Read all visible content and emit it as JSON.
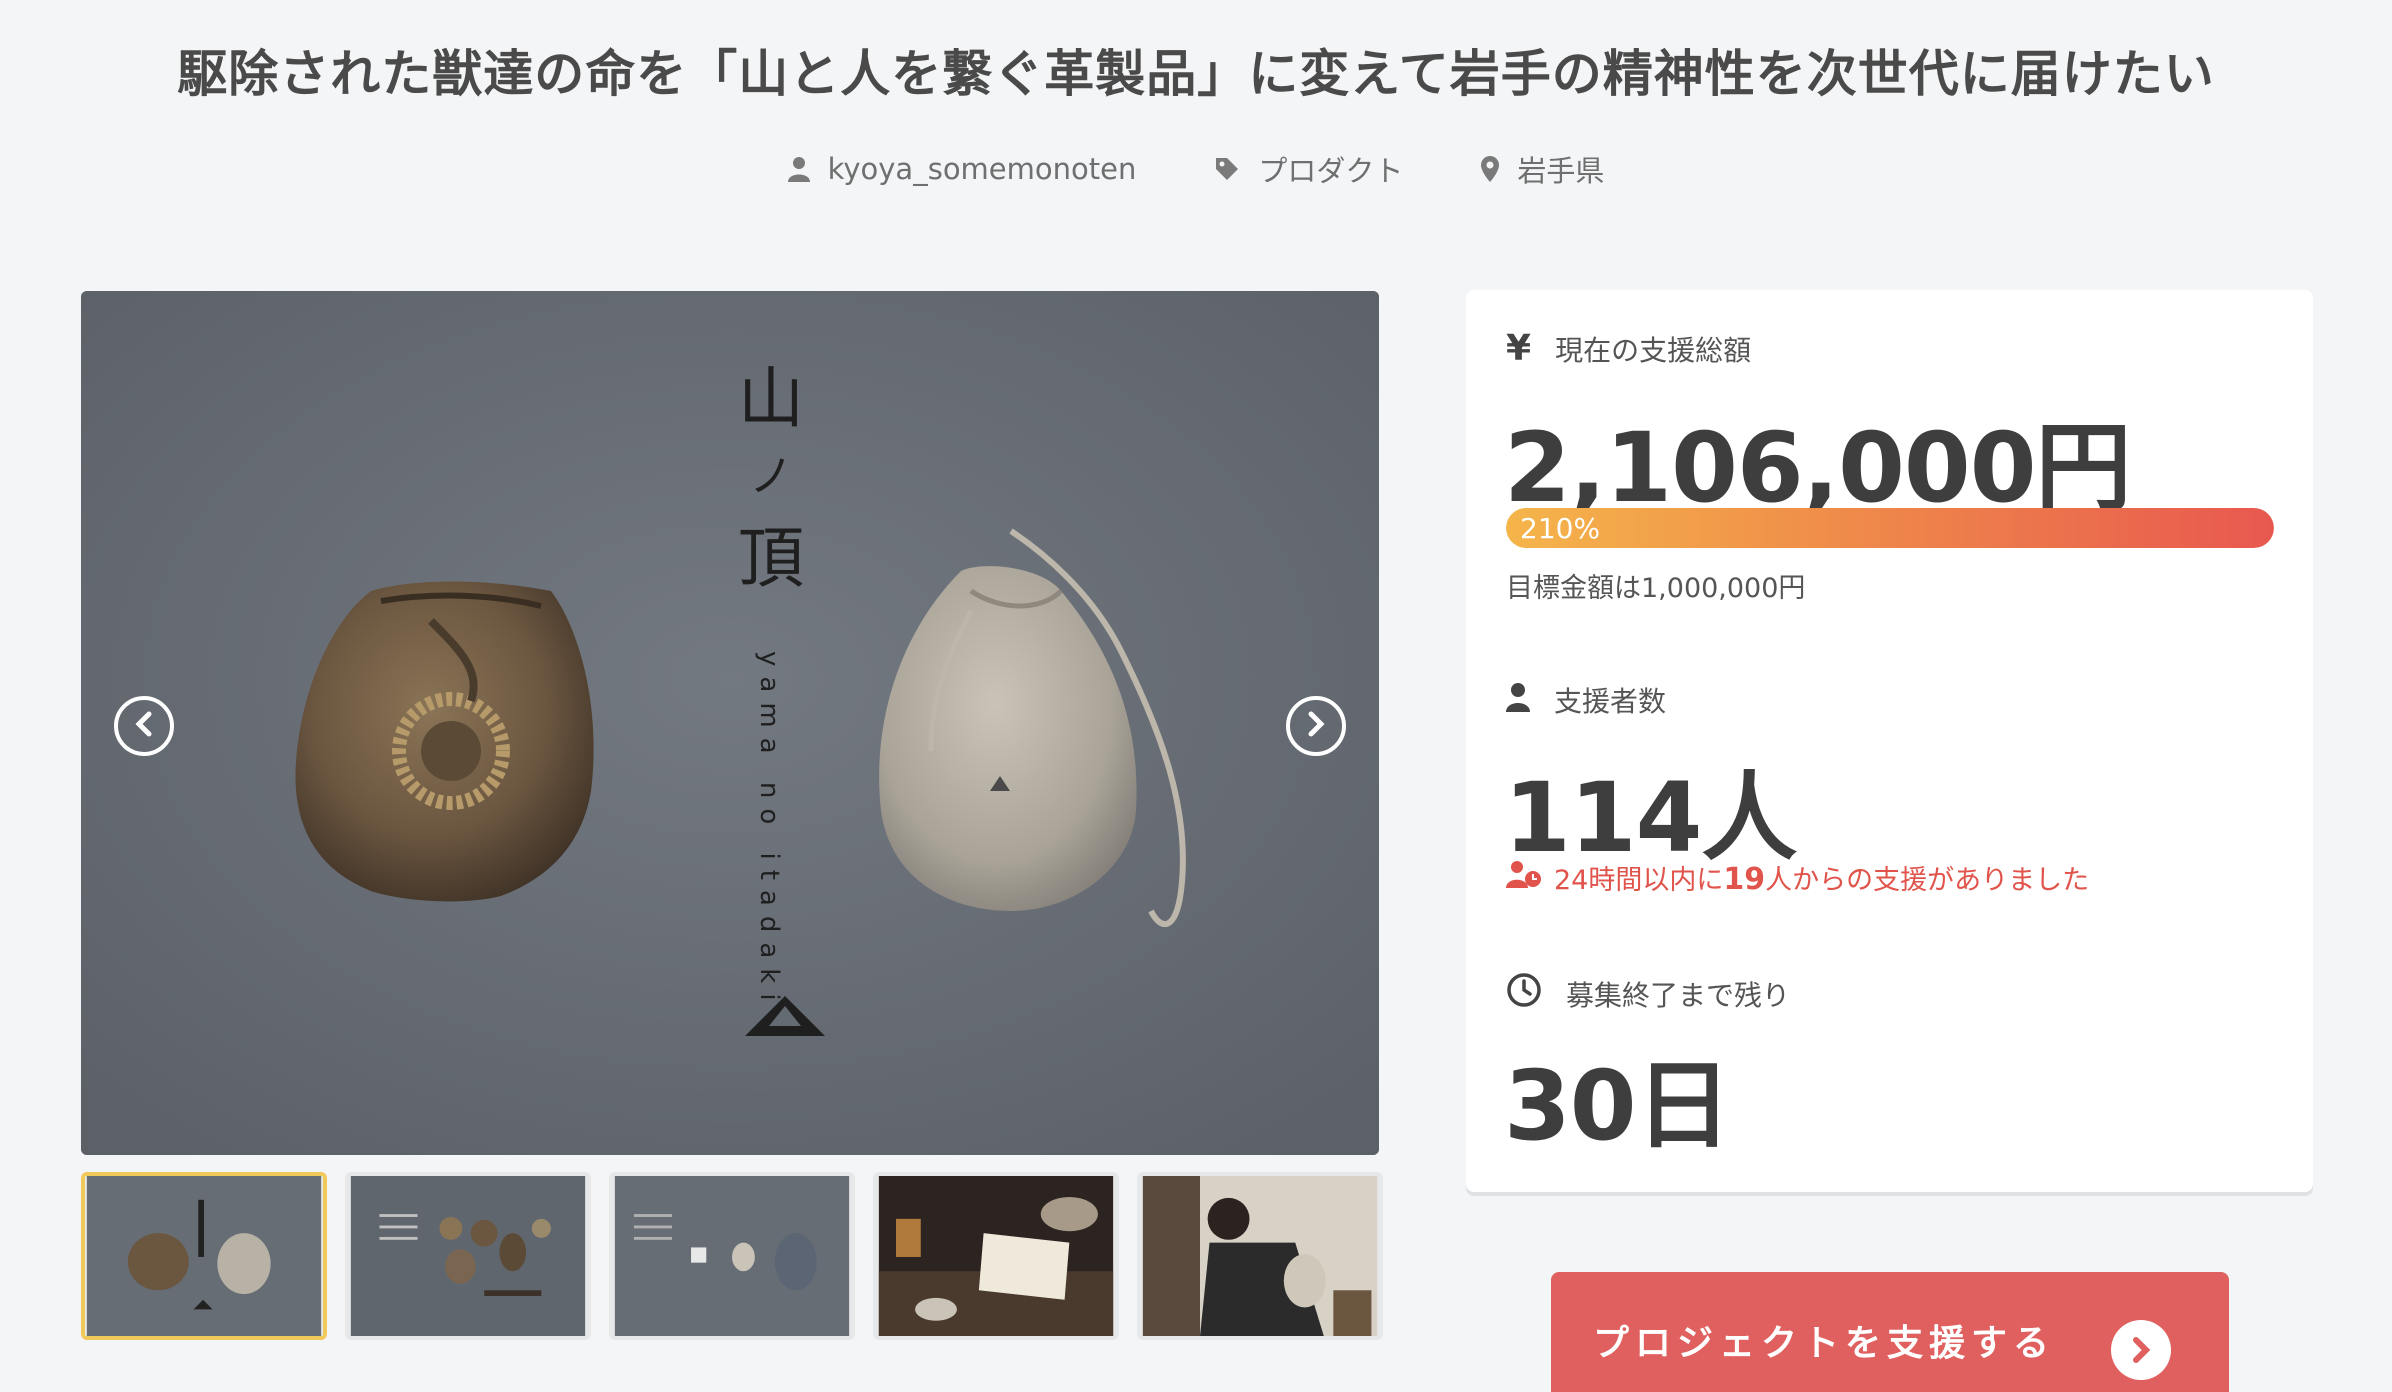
{
  "project": {
    "title": "駆除された獣達の命を「山と人を繋ぐ革製品」に変えて岩手の精神性を次世代に届けたい",
    "owner": "kyoya_somemonoten",
    "category": "プロダクト",
    "location": "岩手県"
  },
  "gallery": {
    "main_title_vertical": "山ノ頂",
    "main_subtitle_vertical": "yama no itadaki",
    "thumbnail_count": 5,
    "active_thumbnail": 1
  },
  "stats": {
    "amount_label": "現在の支援総額",
    "amount": "2,106,000円",
    "progress_percent": 210,
    "progress_label": "210%",
    "goal": "目標金額は1,000,000円",
    "backers_label": "支援者数",
    "backers": "114人",
    "recent_prefix": "24時間以内に",
    "recent_count": "19",
    "recent_suffix": "人からの支援がありました",
    "remaining_label": "募集終了まで残り",
    "remaining": "30日"
  },
  "cta": {
    "support_button": "プロジェクトを支援する"
  },
  "icons": {
    "owner": "user-icon",
    "category": "tag-icon",
    "location": "map-pin-icon",
    "amount": "yen-icon",
    "backers": "user-icon",
    "recent": "user-clock-icon",
    "remaining": "clock-icon"
  },
  "colors": {
    "accent_red": "#e0605f",
    "progress_start": "#f5b54a",
    "progress_end": "#e8584f",
    "active_thumb_border": "#f1c85a"
  }
}
